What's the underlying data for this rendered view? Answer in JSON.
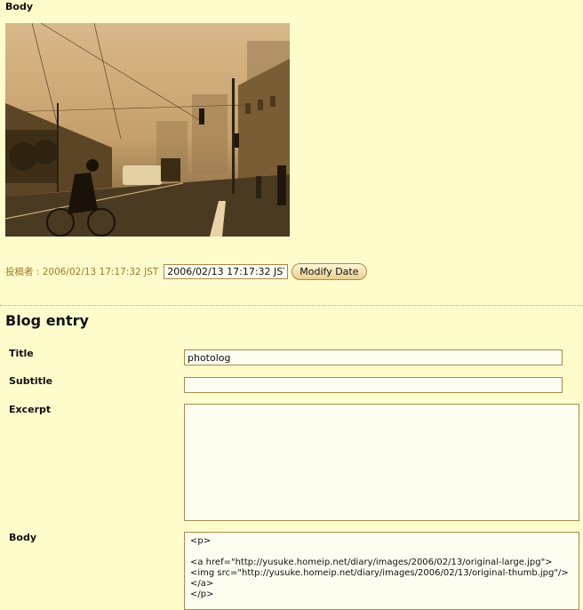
{
  "top": {
    "section_label": "Body",
    "photo_alt": "sepia street photo"
  },
  "meta": {
    "posted_label": "投稿者 : 2006/02/13 17:17:32 JST",
    "date_value": "2006/02/13 17:17:32 JST",
    "modify_button": "Modify Date"
  },
  "blog": {
    "heading": "Blog entry",
    "title_label": "Title",
    "title_value": "photolog",
    "subtitle_label": "Subtitle",
    "subtitle_value": "",
    "excerpt_label": "Excerpt",
    "excerpt_value": "",
    "body_label": "Body",
    "body_value": "<p>\n\n<a href=\"http://yusuke.homeip.net/diary/images/2006/02/13/original-large.jpg\"><img src=\"http://yusuke.homeip.net/diary/images/2006/02/13/original-thumb.jpg\"/></a>\n</p>"
  },
  "colors": {
    "background": "#fffccc",
    "accent": "#a07a2a"
  }
}
